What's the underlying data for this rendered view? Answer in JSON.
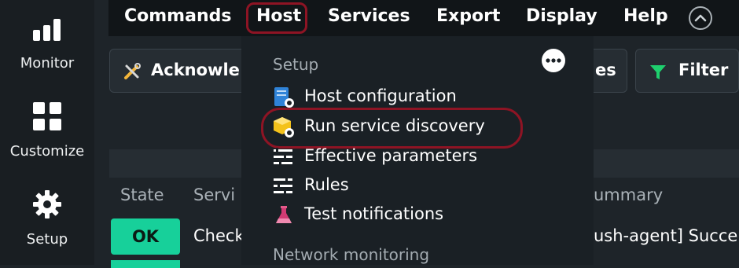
{
  "sidebar": {
    "items": [
      {
        "label": "Monitor",
        "icon": "bar-chart-icon"
      },
      {
        "label": "Customize",
        "icon": "grid-icon"
      },
      {
        "label": "Setup",
        "icon": "gear-icon"
      }
    ]
  },
  "menubar": {
    "items": [
      "Commands",
      "Host",
      "Services",
      "Export",
      "Display",
      "Help"
    ],
    "active": "Host"
  },
  "toolbar": {
    "acknowledge_label": "Acknowle",
    "services_label": "es",
    "filter_label": "Filter"
  },
  "table": {
    "headers": [
      "State",
      "Servi",
      "ummary"
    ],
    "row": {
      "state": "OK",
      "service": "Check",
      "summary": "ush-agent] Succe"
    }
  },
  "dropdown": {
    "section_setup": "Setup",
    "items": [
      {
        "label": "Host configuration",
        "icon": "host-config-icon"
      },
      {
        "label": "Run service discovery",
        "icon": "service-discovery-icon"
      },
      {
        "label": "Effective parameters",
        "icon": "parameters-icon"
      },
      {
        "label": "Rules",
        "icon": "rules-icon"
      },
      {
        "label": "Test notifications",
        "icon": "flask-icon"
      }
    ],
    "section_network": "Network monitoring"
  },
  "colors": {
    "highlight": "#8e1424",
    "ok_state": "#17d09a",
    "filter_icon": "#1ed06e"
  }
}
